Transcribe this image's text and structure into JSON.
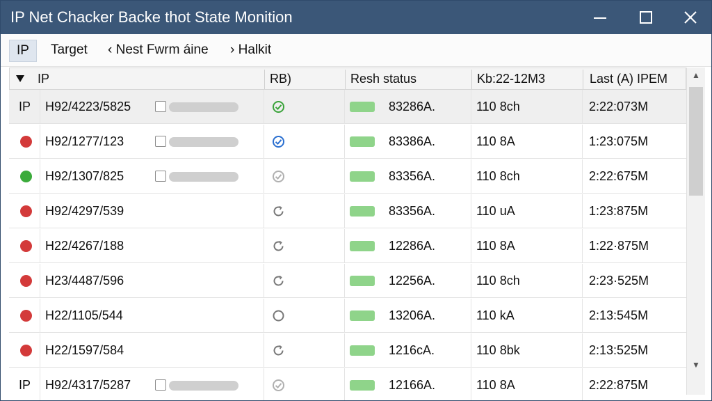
{
  "window": {
    "title": "IP Net Chacker Backe thot State Monition"
  },
  "menu": [
    {
      "label": "IP",
      "active": true
    },
    {
      "label": "Target"
    },
    {
      "label": "‹ Nest Fwrm áine"
    },
    {
      "label": "› Halkit"
    }
  ],
  "columns": {
    "ip": "IP",
    "rb": "RB)",
    "status": "Resh status",
    "info": "Kb:22-12M3",
    "last": "Last (A) IPEM"
  },
  "header_sort_icon": "triangle-down-icon",
  "rows": [
    {
      "lead": "IP",
      "ip": "H92/4223/5825",
      "rb_icon": "check-circle-icon",
      "rb_color": "#3aa33a",
      "status": "83286A.",
      "info": "110 8ch",
      "last": "2:22:073M"
    },
    {
      "dot_color": "#d33a3a",
      "ip": "H92/1277/123",
      "rb_icon": "check-circle-icon",
      "rb_color": "#2a6fd0",
      "status": "83386A.",
      "info": "110 8A",
      "last": "1:23:075M"
    },
    {
      "dot_color": "#3bab3b",
      "ip": "H92/1307/825",
      "rb_icon": "check-circle-icon",
      "rb_color": "#b0b0b0",
      "status": "83356A.",
      "info": "110 8ch",
      "last": "2:22:675M"
    },
    {
      "dot_color": "#d33a3a",
      "ip": "H92/4297/539",
      "rb_icon": "refresh-circle-icon",
      "rb_color": "#777777",
      "status": "83356A.",
      "info": "110 uA",
      "last": "1:23:875M"
    },
    {
      "dot_color": "#d33a3a",
      "ip": "H22/4267/188",
      "rb_icon": "refresh-circle-icon",
      "rb_color": "#777777",
      "status": "12286A.",
      "info": "110 8A",
      "last": "1:22·875M"
    },
    {
      "dot_color": "#d33a3a",
      "ip": "H23/4487/596",
      "rb_icon": "refresh-circle-icon",
      "rb_color": "#777777",
      "status": "12256A.",
      "info": "110 8ch",
      "last": "2:23·525M"
    },
    {
      "dot_color": "#d33a3a",
      "ip": "H22/1105/544",
      "rb_icon": "circle-icon",
      "rb_color": "#777777",
      "status": "13206A.",
      "info": "110 kA",
      "last": "2:13:545M"
    },
    {
      "dot_color": "#d33a3a",
      "ip": "H22/1597/584",
      "rb_icon": "refresh-circle-icon",
      "rb_color": "#777777",
      "status": "1216cA.",
      "info": "110 8bk",
      "last": "2:13:525M"
    },
    {
      "lead": "IP",
      "ip": "H92/4317/5287",
      "rb_icon": "check-circle-icon",
      "rb_color": "#b0b0b0",
      "status": "12166A.",
      "info": "110 8A",
      "last": "2:22:875M"
    }
  ],
  "status_bar_color": "#8fd48a"
}
